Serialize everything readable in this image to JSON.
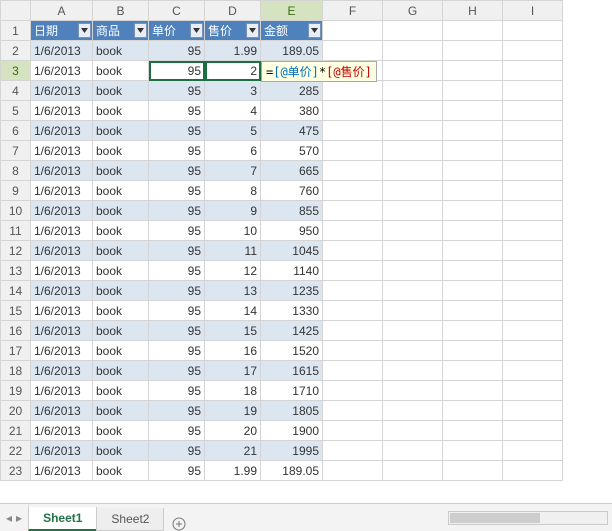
{
  "columns": [
    "A",
    "B",
    "C",
    "D",
    "E",
    "F",
    "G",
    "H",
    "I"
  ],
  "table": {
    "headers": [
      "日期",
      "商品",
      "单价",
      "售价",
      "金额"
    ],
    "rows": [
      {
        "date": "1/6/2013",
        "prod": "book",
        "unit": "95",
        "sell": "1.99",
        "amt": "189.05"
      },
      {
        "date": "1/6/2013",
        "prod": "book",
        "unit": "95",
        "sell": "2",
        "amt": ""
      },
      {
        "date": "1/6/2013",
        "prod": "book",
        "unit": "95",
        "sell": "3",
        "amt": "285"
      },
      {
        "date": "1/6/2013",
        "prod": "book",
        "unit": "95",
        "sell": "4",
        "amt": "380"
      },
      {
        "date": "1/6/2013",
        "prod": "book",
        "unit": "95",
        "sell": "5",
        "amt": "475"
      },
      {
        "date": "1/6/2013",
        "prod": "book",
        "unit": "95",
        "sell": "6",
        "amt": "570"
      },
      {
        "date": "1/6/2013",
        "prod": "book",
        "unit": "95",
        "sell": "7",
        "amt": "665"
      },
      {
        "date": "1/6/2013",
        "prod": "book",
        "unit": "95",
        "sell": "8",
        "amt": "760"
      },
      {
        "date": "1/6/2013",
        "prod": "book",
        "unit": "95",
        "sell": "9",
        "amt": "855"
      },
      {
        "date": "1/6/2013",
        "prod": "book",
        "unit": "95",
        "sell": "10",
        "amt": "950"
      },
      {
        "date": "1/6/2013",
        "prod": "book",
        "unit": "95",
        "sell": "11",
        "amt": "1045"
      },
      {
        "date": "1/6/2013",
        "prod": "book",
        "unit": "95",
        "sell": "12",
        "amt": "1140"
      },
      {
        "date": "1/6/2013",
        "prod": "book",
        "unit": "95",
        "sell": "13",
        "amt": "1235"
      },
      {
        "date": "1/6/2013",
        "prod": "book",
        "unit": "95",
        "sell": "14",
        "amt": "1330"
      },
      {
        "date": "1/6/2013",
        "prod": "book",
        "unit": "95",
        "sell": "15",
        "amt": "1425"
      },
      {
        "date": "1/6/2013",
        "prod": "book",
        "unit": "95",
        "sell": "16",
        "amt": "1520"
      },
      {
        "date": "1/6/2013",
        "prod": "book",
        "unit": "95",
        "sell": "17",
        "amt": "1615"
      },
      {
        "date": "1/6/2013",
        "prod": "book",
        "unit": "95",
        "sell": "18",
        "amt": "1710"
      },
      {
        "date": "1/6/2013",
        "prod": "book",
        "unit": "95",
        "sell": "19",
        "amt": "1805"
      },
      {
        "date": "1/6/2013",
        "prod": "book",
        "unit": "95",
        "sell": "20",
        "amt": "1900"
      },
      {
        "date": "1/6/2013",
        "prod": "book",
        "unit": "95",
        "sell": "21",
        "amt": "1995"
      },
      {
        "date": "1/6/2013",
        "prod": "book",
        "unit": "95",
        "sell": "1.99",
        "amt": "189.05"
      }
    ]
  },
  "formula": {
    "eq": "=",
    "ref1": "[@单价]",
    "op": "*",
    "ref2": "[@售价]"
  },
  "tabs": {
    "sheet1": "Sheet1",
    "sheet2": "Sheet2"
  },
  "nav": {
    "first": "◂",
    "prev": "◂",
    "next": "▸",
    "last": "▸"
  }
}
